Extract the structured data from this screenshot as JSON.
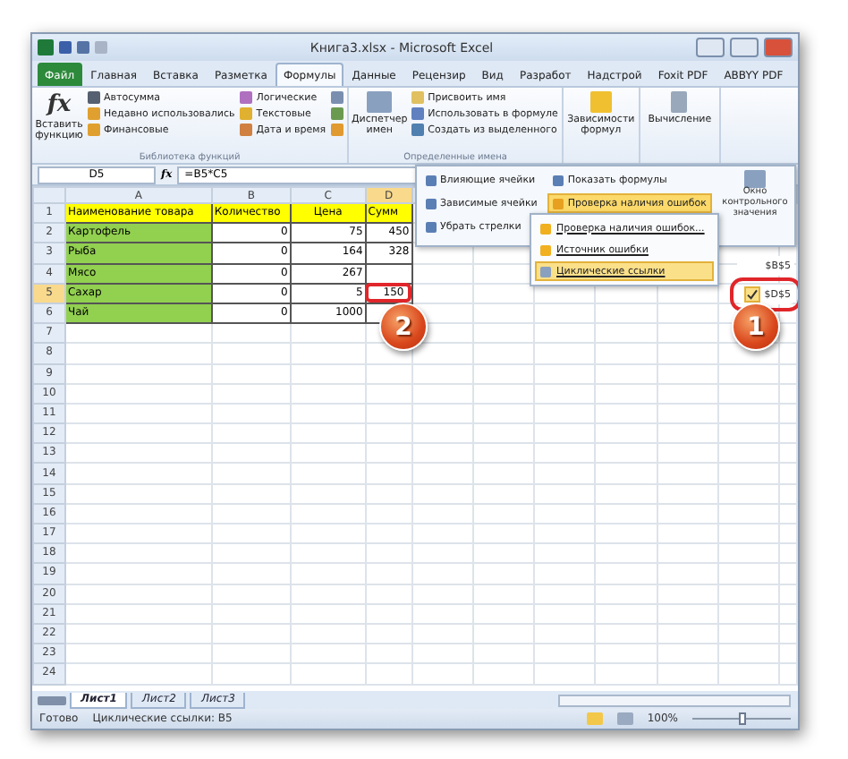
{
  "window": {
    "title": "Книга3.xlsx - Microsoft Excel"
  },
  "ribbon_tabs": [
    {
      "label": "Файл",
      "kind": "file",
      "selected": false
    },
    {
      "label": "Главная",
      "kind": "tab",
      "selected": false
    },
    {
      "label": "Вставка",
      "kind": "tab",
      "selected": false
    },
    {
      "label": "Разметка",
      "kind": "tab",
      "selected": false
    },
    {
      "label": "Формулы",
      "kind": "tab",
      "selected": true
    },
    {
      "label": "Данные",
      "kind": "tab",
      "selected": false
    },
    {
      "label": "Рецензир",
      "kind": "tab",
      "selected": false
    },
    {
      "label": "Вид",
      "kind": "tab",
      "selected": false
    },
    {
      "label": "Разработ",
      "kind": "tab",
      "selected": false
    },
    {
      "label": "Надстрой",
      "kind": "tab",
      "selected": false
    },
    {
      "label": "Foxit PDF",
      "kind": "tab",
      "selected": false
    },
    {
      "label": "ABBYY PDF",
      "kind": "tab",
      "selected": false
    }
  ],
  "function_library": {
    "insert_function": "Вставить функцию",
    "fx": "fx",
    "column_1": [
      "Автосумма",
      "Недавно использовались",
      "Финансовые"
    ],
    "column_2": [
      "Логические",
      "Текстовые",
      "Дата и время"
    ],
    "title": "Библиотека функций"
  },
  "defined_names": {
    "name_manager": "Диспетчер имен",
    "items": [
      "Присвоить имя",
      "Использовать в формуле",
      "Создать из выделенного"
    ],
    "title": "Определенные имена"
  },
  "formula_dependencies": "Зависимости формул",
  "calculation": "Вычисление",
  "formula_bar": {
    "name_box": "D5",
    "fx": "fx",
    "formula": "=B5*C5"
  },
  "sheet": {
    "columns": [
      {
        "label": "A",
        "selected": false
      },
      {
        "label": "B",
        "selected": false
      },
      {
        "label": "C",
        "selected": false
      },
      {
        "label": "D",
        "selected": true
      }
    ],
    "rows": [
      {
        "number": "1",
        "selected": false,
        "cells": [
          {
            "text": "Наименование товара",
            "kind": "text",
            "color": "#ffff00"
          },
          {
            "text": "Количество",
            "kind": "text",
            "color": "#ffff00"
          },
          {
            "text": "Цена",
            "kind": "center",
            "color": "#ffff00"
          },
          {
            "text": "Сумм",
            "kind": "text",
            "color": "#ffff00"
          }
        ]
      },
      {
        "number": "2",
        "selected": false,
        "cells": [
          {
            "text": "Картофель",
            "kind": "text",
            "color": "#92d050"
          },
          {
            "text": "0",
            "kind": "number"
          },
          {
            "text": "75",
            "kind": "number"
          },
          {
            "text": "450",
            "kind": "number"
          }
        ]
      },
      {
        "number": "3",
        "selected": false,
        "cells": [
          {
            "text": "Рыба",
            "kind": "text",
            "color": "#92d050"
          },
          {
            "text": "0",
            "kind": "number"
          },
          {
            "text": "164",
            "kind": "number"
          },
          {
            "text": "328",
            "kind": "number"
          }
        ]
      },
      {
        "number": "4",
        "selected": false,
        "cells": [
          {
            "text": "Мясо",
            "kind": "text",
            "color": "#92d050"
          },
          {
            "text": "0",
            "kind": "number"
          },
          {
            "text": "267",
            "kind": "number"
          }
        ]
      },
      {
        "number": "5",
        "selected": true,
        "cells": [
          {
            "text": "Сахар",
            "kind": "text",
            "color": "#92d050"
          },
          {
            "text": "0",
            "kind": "number"
          },
          {
            "text": "5",
            "kind": "number"
          },
          {
            "text": "150",
            "kind": "number",
            "circled": true
          }
        ]
      },
      {
        "number": "6",
        "selected": false,
        "cells": [
          {
            "text": "Чай",
            "kind": "text",
            "color": "#92d050"
          },
          {
            "text": "0",
            "kind": "number"
          },
          {
            "text": "1000",
            "kind": "number"
          }
        ]
      },
      {
        "number": "7",
        "selected": false
      },
      {
        "number": "8",
        "selected": false
      },
      {
        "number": "9",
        "selected": false
      },
      {
        "number": "10",
        "selected": false
      },
      {
        "number": "11",
        "selected": false
      },
      {
        "number": "12",
        "selected": false
      },
      {
        "number": "13",
        "selected": false
      },
      {
        "number": "14",
        "selected": false
      },
      {
        "number": "15",
        "selected": false
      },
      {
        "number": "16",
        "selected": false
      },
      {
        "number": "17",
        "selected": false
      },
      {
        "number": "18",
        "selected": false
      },
      {
        "number": "19",
        "selected": false
      },
      {
        "number": "20",
        "selected": false
      },
      {
        "number": "21",
        "selected": false
      },
      {
        "number": "22",
        "selected": false
      },
      {
        "number": "23",
        "selected": false
      },
      {
        "number": "24",
        "selected": false
      }
    ]
  },
  "dependencies_menu": {
    "column_1": [
      "Влияющие ячейки",
      "Зависимые ячейки",
      "Убрать стрелки"
    ],
    "show_formulas": "Показать формулы",
    "error_check": "Проверка наличия ошибок",
    "watch_window": "Окно контрольного значения"
  },
  "error_menu": [
    {
      "label": "Проверка наличия ошибок...",
      "selected": false
    },
    {
      "label": "Источник ошибки",
      "selected": false
    },
    {
      "label": "Циклические ссылки",
      "selected": true
    }
  ],
  "circular_refs": [
    {
      "label": "$B$5",
      "checked": false,
      "circled": false
    },
    {
      "label": "$D$5",
      "checked": true,
      "circled": true
    }
  ],
  "callouts": [
    "2",
    "1"
  ],
  "sheet_tabs": [
    {
      "label": "Лист1",
      "selected": true
    },
    {
      "label": "Лист2",
      "selected": false
    },
    {
      "label": "Лист3",
      "selected": false
    }
  ],
  "status_bar": {
    "ready": "Готово",
    "circular": "Циклические ссылки: B5",
    "zoom": "100%",
    "zoom_slider": {
      "level": 0.5
    }
  }
}
